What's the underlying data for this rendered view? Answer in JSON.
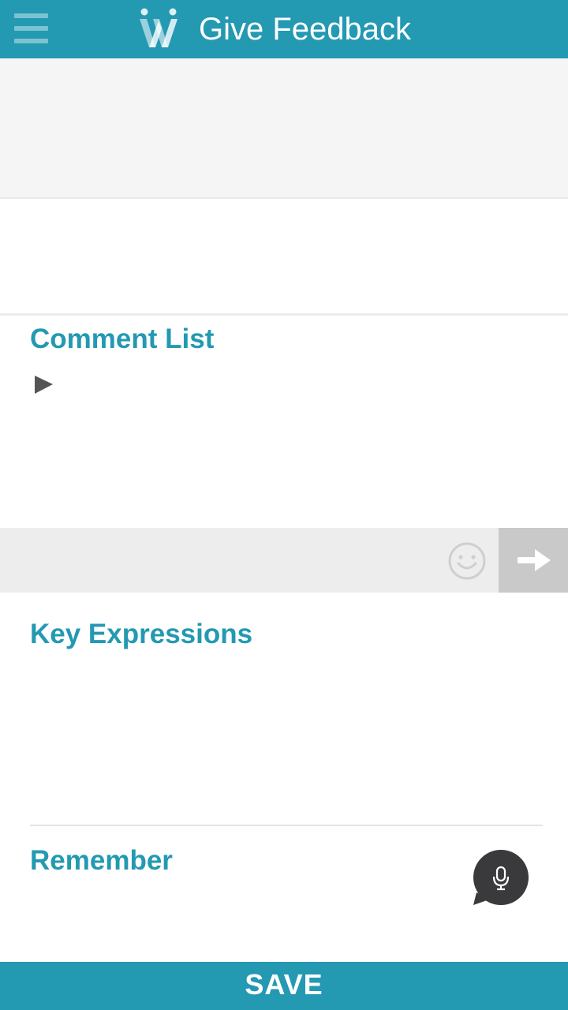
{
  "header": {
    "title": "Give Feedback",
    "background": "#2399b2"
  },
  "comment_section": {
    "title": "Comment List",
    "input_placeholder": ""
  },
  "key_expressions": {
    "title": "Key Expressions"
  },
  "remember": {
    "title": "Remember"
  },
  "footer": {
    "save_label": "SAVE"
  },
  "icons": {
    "menu": "hamburger-menu-icon",
    "logo": "w-logo-icon",
    "toggle": "play-triangle-icon",
    "emoji": "smiley-icon",
    "send": "arrow-right-icon",
    "mic": "microphone-icon"
  },
  "colors": {
    "accent": "#2399b2",
    "panel_grey": "#f5f5f5",
    "input_bar": "#ededed",
    "send_button": "#c9c9c9",
    "mic_bubble": "#3a3a3c"
  }
}
